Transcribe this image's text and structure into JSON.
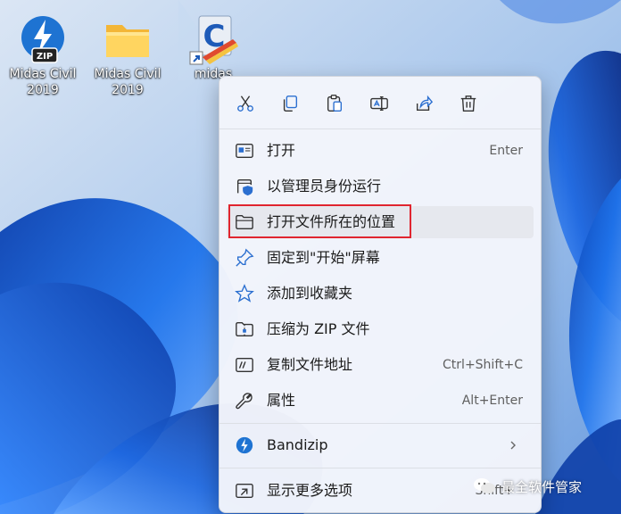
{
  "desktop": {
    "icons": [
      {
        "label": "Midas Civil\n2019",
        "icon": "bandizip-zip-icon"
      },
      {
        "label": "Midas Civil\n2019",
        "icon": "folder-icon"
      },
      {
        "label": "midas",
        "icon": "midas-civil-shortcut-icon"
      }
    ],
    "zip_badge": "ZIP",
    "midas_letter": "C"
  },
  "context_menu": {
    "toolbar": [
      {
        "name": "cut",
        "icon": "scissors-icon"
      },
      {
        "name": "copy",
        "icon": "copy-icon"
      },
      {
        "name": "paste",
        "icon": "paste-icon"
      },
      {
        "name": "rename",
        "icon": "rename-icon"
      },
      {
        "name": "share",
        "icon": "share-icon"
      },
      {
        "name": "delete",
        "icon": "trash-icon"
      }
    ],
    "items": [
      {
        "label": "打开",
        "accel": "Enter",
        "icon": "open-window-icon"
      },
      {
        "label": "以管理员身份运行",
        "accel": "",
        "icon": "shield-window-icon"
      },
      {
        "label": "打开文件所在的位置",
        "accel": "",
        "icon": "folder-outline-icon",
        "highlighted": true
      },
      {
        "label": "固定到\"开始\"屏幕",
        "accel": "",
        "icon": "pin-icon"
      },
      {
        "label": "添加到收藏夹",
        "accel": "",
        "icon": "star-icon"
      },
      {
        "label": "压缩为 ZIP 文件",
        "accel": "",
        "icon": "zip-folder-icon"
      },
      {
        "label": "复制文件地址",
        "accel": "Ctrl+Shift+C",
        "icon": "copy-path-icon"
      },
      {
        "label": "属性",
        "accel": "Alt+Enter",
        "icon": "wrench-icon"
      }
    ],
    "bandizip": {
      "label": "Bandizip",
      "icon": "bandizip-icon",
      "has_submenu": true
    },
    "more_options": {
      "label": "显示更多选项",
      "accel": "Shift+"
    }
  },
  "watermark": {
    "text": "最全软件管家",
    "icon": "wechat-icon"
  },
  "colors": {
    "highlight_border": "#e0252f",
    "bandizip_blue": "#1e73d2",
    "icon_blue": "#2b6fd0"
  }
}
